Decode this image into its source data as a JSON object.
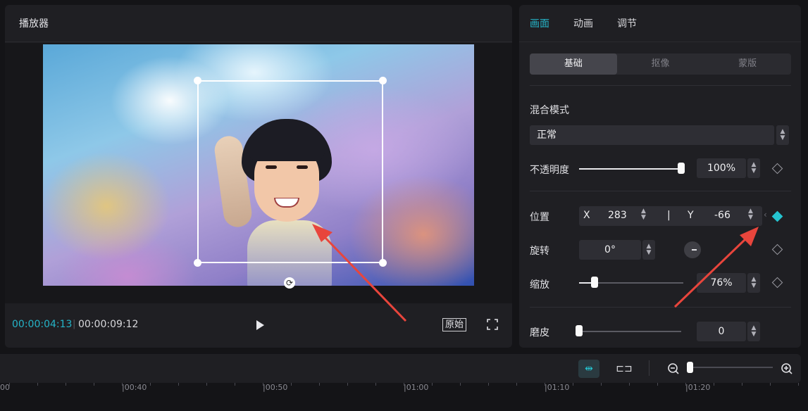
{
  "player": {
    "title": "播放器",
    "time_current": "00:00:04:13",
    "time_total": "00:00:09:12",
    "original_label": "原始"
  },
  "inspector": {
    "tabs": [
      {
        "label": "画面",
        "active": true
      },
      {
        "label": "动画",
        "active": false
      },
      {
        "label": "调节",
        "active": false
      }
    ],
    "subtabs": [
      {
        "label": "基础",
        "active": true
      },
      {
        "label": "抠像",
        "active": false
      },
      {
        "label": "蒙版",
        "active": false
      }
    ],
    "blend_mode": {
      "label": "混合模式",
      "value": "正常"
    },
    "opacity": {
      "label": "不透明度",
      "value": "100%",
      "fraction": 1.0
    },
    "position": {
      "label": "位置",
      "x_label": "X",
      "x_value": "283",
      "sep": "|",
      "y_label": "Y",
      "y_value": "-66",
      "keyframe_active": true
    },
    "rotation": {
      "label": "旋转",
      "value": "0°"
    },
    "scale": {
      "label": "缩放",
      "value": "76%"
    },
    "smoothing": {
      "label": "磨皮",
      "value": "0",
      "fraction": 0.0
    }
  },
  "timeline": {
    "ruler_labels": [
      "00",
      "|00:40",
      "|00:50",
      "|01:00",
      "|01:10",
      "|01:20"
    ]
  },
  "colors": {
    "accent": "#25b4c8",
    "annotation_arrow": "#e8453c"
  }
}
